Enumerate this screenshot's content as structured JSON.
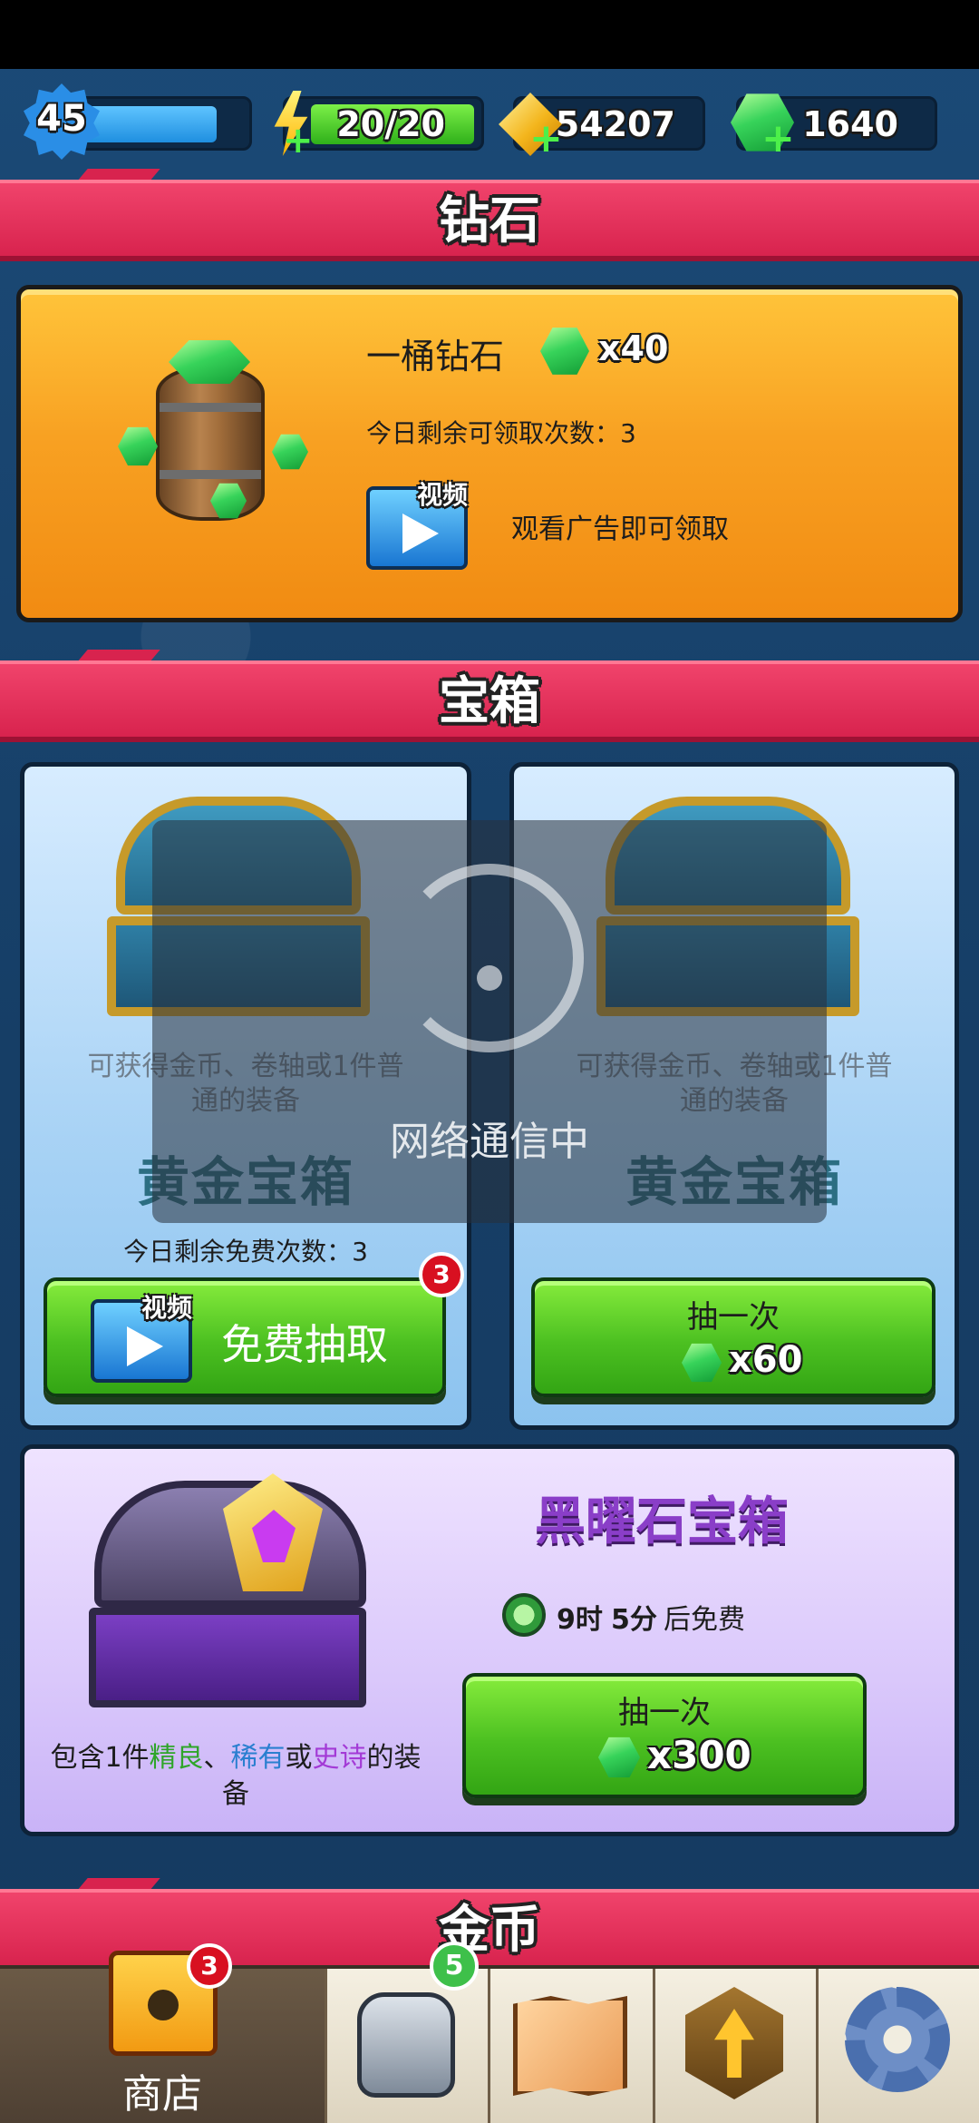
{
  "header": {
    "level": "45",
    "energy": "20/20",
    "gold": "54207",
    "gems": "1640"
  },
  "sections": {
    "diamonds": "钻石",
    "chests": "宝箱",
    "coins": "金币"
  },
  "diamond_offer": {
    "title": "一桶钻石",
    "amount": "x40",
    "remaining": "今日剩余可领取次数：3",
    "video_tag": "视频",
    "watch_text": "观看广告即可领取"
  },
  "gold_chest_left": {
    "desc_line1": "可获得金币、卷轴或1件普",
    "desc_line2": "通的装备",
    "name": "黄金宝箱",
    "free_remaining": "今日剩余免费次数：3",
    "video_tag": "视频",
    "button_label": "免费抽取",
    "badge": "3"
  },
  "gold_chest_right": {
    "desc_line1": "可获得金币、卷轴或1件普",
    "desc_line2": "通的装备",
    "name": "黄金宝箱",
    "button_label": "抽一次",
    "price": "x60"
  },
  "loading": {
    "text": "网络通信中"
  },
  "obsidian_chest": {
    "name": "黑曜石宝箱",
    "timer_h": "9时",
    "timer_m": "5分",
    "timer_suffix": "后免费",
    "desc_prefix": "包含1件",
    "desc_fine": "精良",
    "desc_sep": "、",
    "desc_rare": "稀有",
    "desc_or": "或",
    "desc_epic": "史诗",
    "desc_suffix": "的装",
    "desc_line2": "备",
    "button_label": "抽一次",
    "price": "x300",
    "colors": {
      "fine": "#2fa52a",
      "rare": "#2a7fd0",
      "epic": "#a33ad6"
    }
  },
  "nav": {
    "shop_label": "商店",
    "shop_badge": "3",
    "equipment_badge": "5",
    "icons": [
      "shop-chest-icon",
      "armor-icon",
      "map-icon",
      "upgrade-arrow-icon",
      "gear-icon"
    ]
  }
}
